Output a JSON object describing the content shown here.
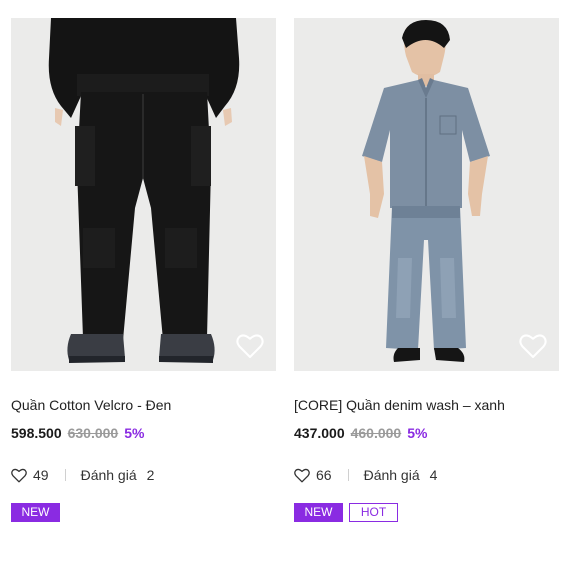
{
  "products": [
    {
      "title": "Quần Cotton Velcro - Đen",
      "price": "598.500",
      "old_price": "630.000",
      "discount": "5%",
      "likes": "49",
      "rating_label": "Đánh giá",
      "rating_count": "2",
      "tags": [
        "NEW"
      ],
      "image": "black-cargo-pants-photo"
    },
    {
      "title": "[CORE] Quần denim wash – xanh",
      "price": "437.000",
      "old_price": "460.000",
      "discount": "5%",
      "likes": "66",
      "rating_label": "Đánh giá",
      "rating_count": "4",
      "tags": [
        "NEW",
        "HOT"
      ],
      "image": "denim-outfit-photo"
    }
  ],
  "colors": {
    "accent": "#8a2be2",
    "image_bg": "#ebebea",
    "old_price": "#9a9a9a"
  },
  "icons": {
    "wishlist": "heart-outline-icon",
    "likes": "heart-outline-icon"
  }
}
